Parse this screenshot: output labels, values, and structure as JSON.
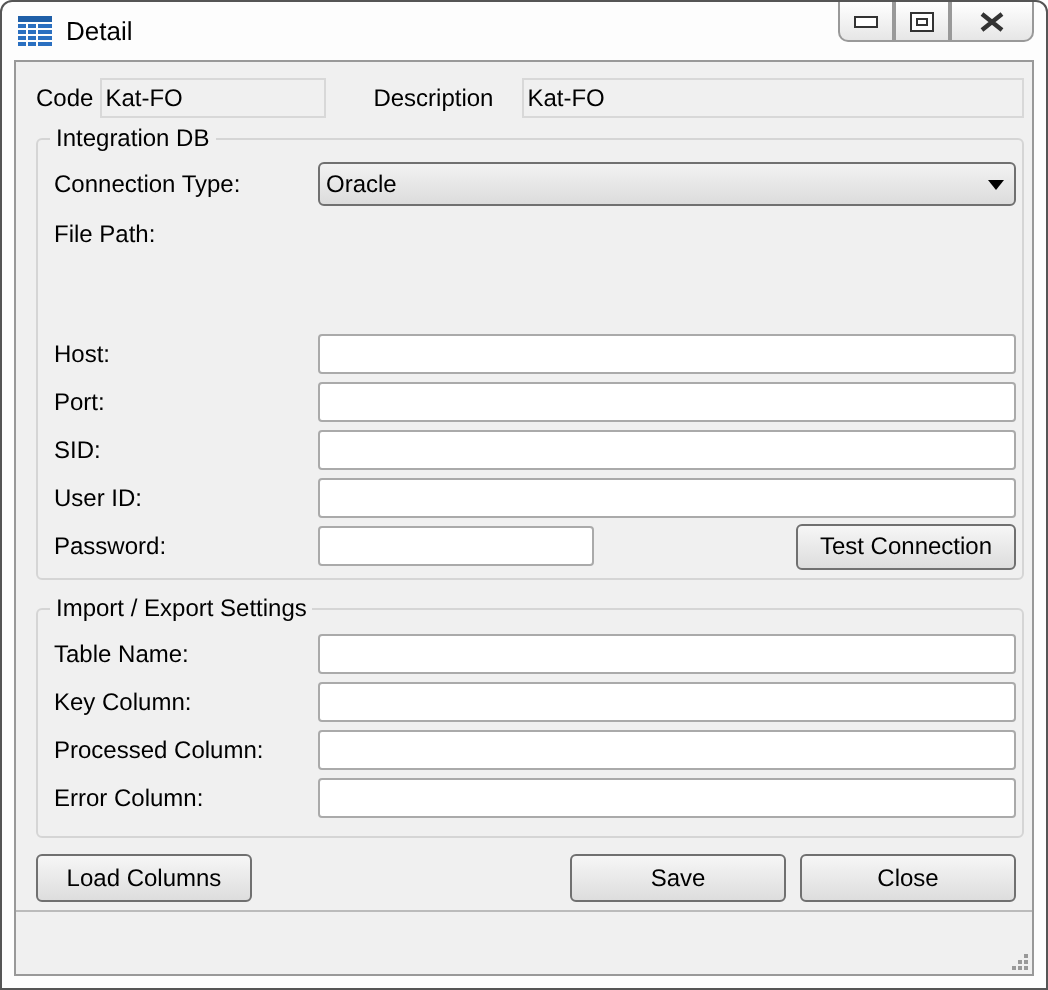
{
  "window": {
    "title": "Detail"
  },
  "header": {
    "code": {
      "label": "Code",
      "value": "Kat-FO"
    },
    "description": {
      "label": "Description",
      "value": "Kat-FO"
    }
  },
  "integration_db": {
    "title": "Integration DB",
    "connection_type": {
      "label": "Connection Type:",
      "value": "Oracle"
    },
    "file_path": {
      "label": "File Path:"
    },
    "fields": [
      {
        "label": "Host:",
        "kind": "full"
      },
      {
        "label": "Port:",
        "kind": "full"
      },
      {
        "label": "SID:",
        "kind": "full"
      },
      {
        "label": "User ID:",
        "kind": "full"
      },
      {
        "label": "Password:",
        "kind": "short"
      }
    ],
    "test_button": "Test Connection"
  },
  "import_export": {
    "title": "Import / Export Settings",
    "fields": [
      {
        "label": "Table Name:"
      },
      {
        "label": "Key Column:"
      },
      {
        "label": "Processed Column:"
      },
      {
        "label": "Error Column:"
      }
    ]
  },
  "buttons": {
    "left": [
      "Load Columns"
    ],
    "right": [
      "Save",
      "Close"
    ]
  }
}
